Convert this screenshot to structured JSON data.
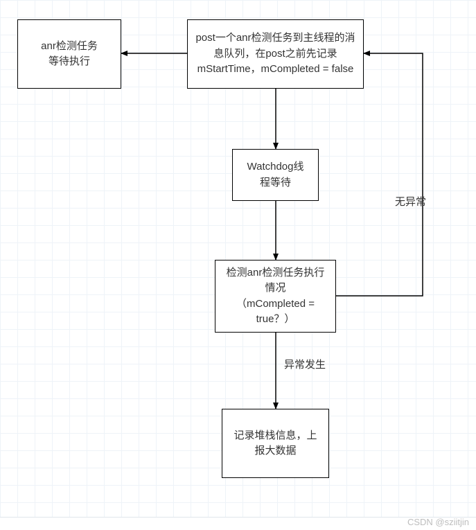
{
  "nodes": {
    "wait_task": "anr检测任务\n等待执行",
    "post_task": "post一个anr检测任务到主线程的消息队列，在post之前先记录mStartTime，mCompleted = false",
    "watchdog_wait": "Watchdog线\n程等待",
    "check_status": "检测anr检测任务执行情况\n（mCompleted = true？）",
    "record_stack": "记录堆栈信息，上报大数据"
  },
  "edges": {
    "no_exception": "无异常",
    "exception": "异常发生"
  },
  "watermark": "CSDN @sziitjin"
}
